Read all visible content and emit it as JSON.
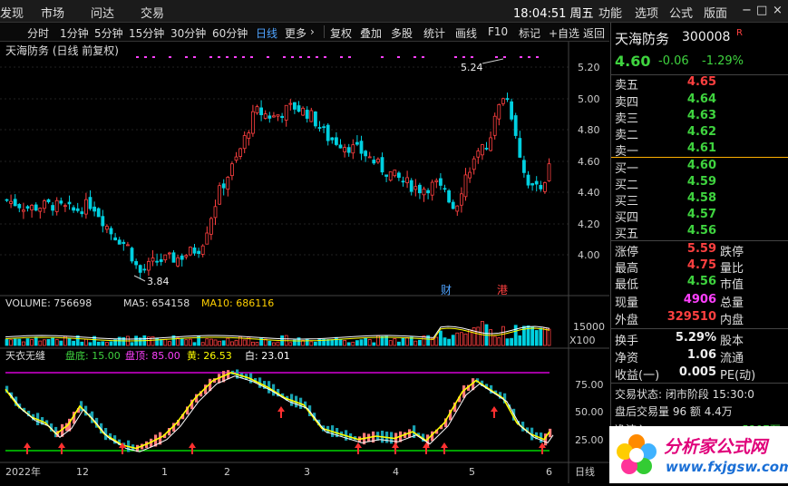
{
  "menubar": {
    "items": [
      "发现",
      "市场",
      "问达",
      "交易"
    ],
    "right_items": [
      "功能",
      "选项",
      "公式",
      "版面"
    ],
    "clock": "18:04:51 周五",
    "window_controls": [
      "−",
      "□",
      "×"
    ]
  },
  "toolbar": {
    "periods": [
      "分时",
      "1分钟",
      "5分钟",
      "15分钟",
      "30分钟",
      "60分钟",
      "日线",
      "更多"
    ],
    "active": "日线",
    "more_arrow": "›",
    "tools": [
      "复权",
      "叠加",
      "多股",
      "统计",
      "画线",
      "F10",
      "标记",
      "+自选",
      "返回"
    ]
  },
  "price_panel": {
    "title": "天海防务 (日线 前复权)",
    "y_ticks": [
      "5.20",
      "5.00",
      "4.80",
      "4.60",
      "4.40",
      "4.20",
      "4.00"
    ],
    "high_label": "5.24",
    "low_label": "3.84",
    "markers": [
      "财",
      "港"
    ]
  },
  "volume_panel": {
    "volume_label": "VOLUME: 756698",
    "ma5_label": "MA5: 654158",
    "ma10_label": "MA10: 686116",
    "y_tick": "15000",
    "unit": "X100"
  },
  "indicator_panel": {
    "name": "天衣无缝",
    "bottom_label": "盘底: 15.00",
    "top_label": "盘顶: 85.00",
    "yellow_label": "黄: 26.53",
    "white_label": "白: 23.01",
    "y_ticks": [
      "75.00",
      "50.00",
      "25.00"
    ]
  },
  "x_axis": {
    "labels": [
      "2022年",
      "12",
      "1",
      "2",
      "3",
      "4",
      "5",
      "6"
    ],
    "period": "日线"
  },
  "quote": {
    "name": "天海防务",
    "code": "300008",
    "flag": "R",
    "price": "4.60",
    "change": "-0.06",
    "pct": "-1.29%",
    "asks": [
      {
        "label": "卖五",
        "price": "4.65"
      },
      {
        "label": "卖四",
        "price": "4.64"
      },
      {
        "label": "卖三",
        "price": "4.63"
      },
      {
        "label": "卖二",
        "price": "4.62"
      },
      {
        "label": "卖一",
        "price": "4.61"
      }
    ],
    "bids": [
      {
        "label": "买一",
        "price": "4.60"
      },
      {
        "label": "买二",
        "price": "4.59"
      },
      {
        "label": "买三",
        "price": "4.58"
      },
      {
        "label": "买四",
        "price": "4.57"
      },
      {
        "label": "买五",
        "price": "4.56"
      }
    ],
    "stats": [
      {
        "label": "涨停",
        "value": "5.59",
        "extra": "跌停"
      },
      {
        "label": "最高",
        "value": "4.75",
        "extra": "量比"
      },
      {
        "label": "最低",
        "value": "4.56",
        "extra": "市值"
      },
      {
        "label": "现量",
        "value": "4906",
        "extra": "总量"
      },
      {
        "label": "外盘",
        "value": "329510",
        "extra": "内盘"
      }
    ],
    "fundamentals": [
      {
        "label": "换手",
        "value": "5.29%",
        "extra": "股本"
      },
      {
        "label": "净资",
        "value": "1.06",
        "extra": "流通"
      },
      {
        "label": "收益(一)",
        "value": "0.005",
        "extra": "PE(动)"
      }
    ],
    "trade_status": "交易状态: 闭市阶段 15:30:0",
    "after_hours": "盘后交易量 96 额 4.4万",
    "inflow_label": "净流入",
    "inflow_value": "-5297万"
  },
  "logo": {
    "text": "分析家公式网",
    "url_text": "www.fxjgsw.com"
  },
  "colors": {
    "up": "#ff4040",
    "down": "#00d0e0",
    "ma": "#ffff00",
    "top_line": "#ff00ff",
    "bottom_line": "#00ff00"
  }
}
